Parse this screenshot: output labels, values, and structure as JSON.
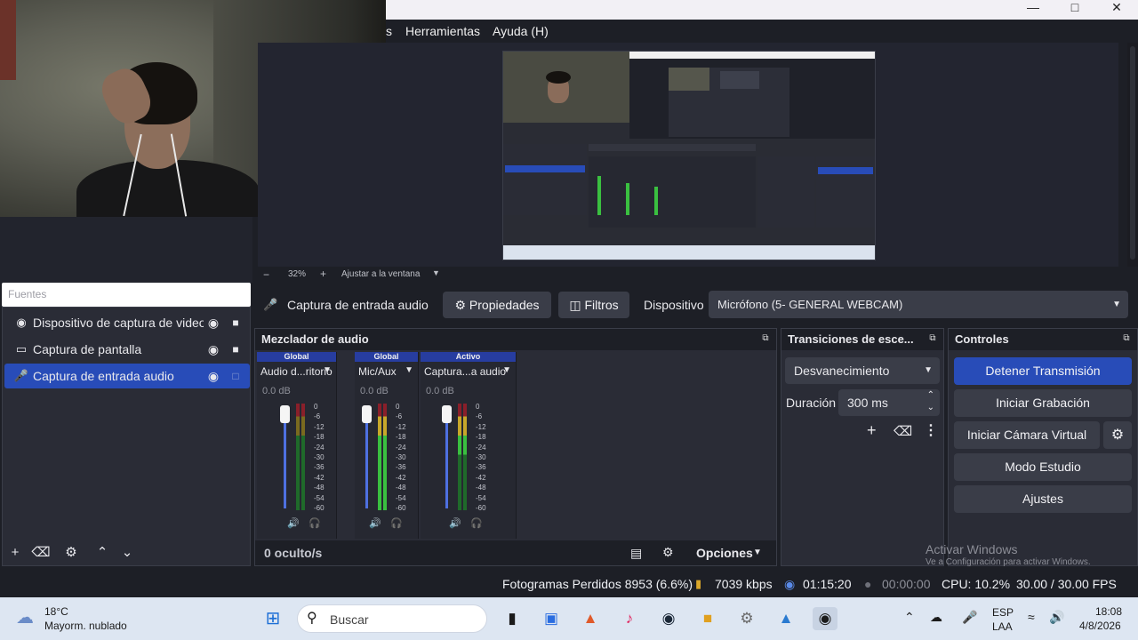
{
  "window": {
    "menu": [
      "s",
      "Herramientas",
      "Ayuda (H)"
    ],
    "controls": [
      "minimize-icon",
      "maximize-icon",
      "close-icon"
    ]
  },
  "preview": {
    "zoom": "32%",
    "zoom_minus": "−",
    "zoom_plus": "+",
    "fit_label": "Ajustar a la ventana"
  },
  "sources": {
    "title": "Fuentes",
    "items": [
      {
        "icon": "camera-icon",
        "label": "Dispositivo de captura de video",
        "selected": false
      },
      {
        "icon": "monitor-icon",
        "label": "Captura de pantalla",
        "selected": false
      },
      {
        "icon": "microphone-icon",
        "label": "Captura de entrada audio",
        "selected": true
      }
    ]
  },
  "context": {
    "source": "Captura de entrada audio",
    "properties": "Propiedades",
    "filters": "Filtros",
    "device_label": "Dispositivo",
    "device_value": "Micrófono (5- GENERAL WEBCAM)"
  },
  "mixer": {
    "title": "Mezclador de audio",
    "channels": [
      {
        "badge": "Global",
        "name": "Audio d...ritorio",
        "db": "0.0 dB"
      },
      {
        "badge": "Global",
        "name": "Mic/Aux",
        "db": "0.0 dB"
      },
      {
        "badge": "Activo",
        "name": "Captura...a audio",
        "db": "0.0 dB"
      }
    ],
    "scale": [
      "0",
      "-6",
      "-12",
      "-18",
      "-24",
      "-30",
      "-36",
      "-42",
      "-48",
      "-54",
      "-60"
    ],
    "hidden": "0 oculto/s",
    "options": "Opciones"
  },
  "transitions": {
    "title": "Transiciones de esce...",
    "type": "Desvanecimiento",
    "duration_label": "Duración",
    "duration_value": "300 ms"
  },
  "controls": {
    "title": "Controles",
    "stop_stream": "Detener Transmisión",
    "start_recording": "Iniciar Grabación",
    "virtual_cam": "Iniciar Cámara Virtual",
    "studio_mode": "Modo Estudio",
    "settings": "Ajustes"
  },
  "watermark": {
    "line1": "Activar Windows",
    "line2": "Ve a Configuración para activar Windows."
  },
  "status": {
    "dropped": "Fotogramas Perdidos 8953 (6.6%)",
    "bitrate": "7039 kbps",
    "stream_time": "01:15:20",
    "rec_time": "00:00:00",
    "cpu": "CPU: 10.2%",
    "fps": "30.00 / 30.00 FPS"
  },
  "taskbar": {
    "weather_temp": "18°C",
    "weather_desc": "Mayorm. nublado",
    "search": "Buscar",
    "lang1": "ESP",
    "lang2": "LAA",
    "time": "18:08",
    "date": "4/8/2026"
  },
  "colors": {
    "accent": "#284cb8",
    "panel": "#2a2c36",
    "background": "#1d1f26"
  }
}
